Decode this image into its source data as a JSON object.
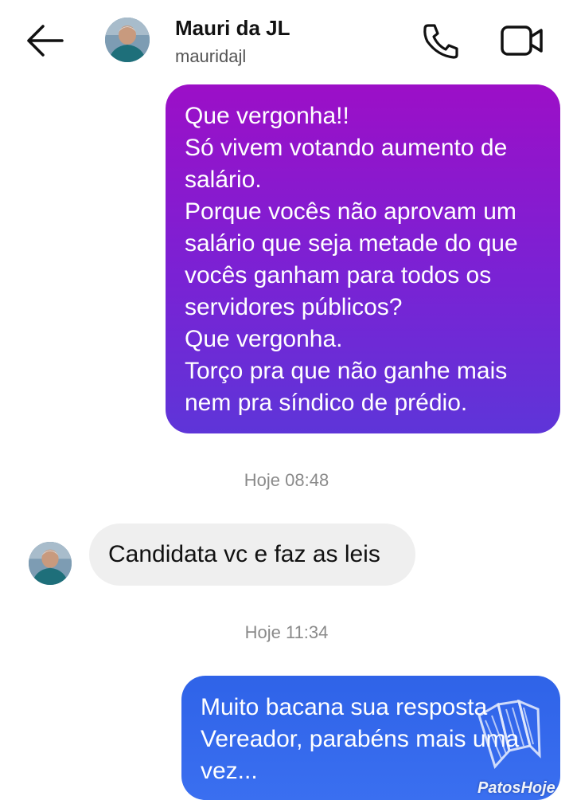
{
  "header": {
    "back_icon": "arrow-left-icon",
    "contact_name": "Mauri da JL",
    "contact_handle": "mauridajl",
    "call_icon": "phone-icon",
    "video_icon": "video-camera-icon"
  },
  "messages": [
    {
      "direction": "outgoing",
      "text": "Que vergonha!!\nSó vivem votando aumento de salário.\nPorque vocês não aprovam um salário que seja metade do que vocês ganham para todos os servidores públicos?\nQue vergonha.\nTorço pra que não ganhe mais nem pra síndico de prédio."
    },
    {
      "type": "timestamp",
      "text": "Hoje 08:48"
    },
    {
      "direction": "incoming",
      "text": "Candidata vc e faz as leis"
    },
    {
      "type": "timestamp",
      "text": "Hoje 11:34"
    },
    {
      "direction": "outgoing",
      "text": "Muito bacana sua resposta Vereador, parabéns mais uma vez..."
    }
  ],
  "colors": {
    "outgoing_gradient_top": "#9c0fc7",
    "outgoing_gradient_bottom": "#5e35d8",
    "outgoing_blue": "#3a6ff0",
    "incoming_bg": "#efefef",
    "timestamp_text": "#8a8a8a"
  },
  "watermark": {
    "text": "PatosHoje",
    "logo_icon": "watermark-logo-icon"
  }
}
